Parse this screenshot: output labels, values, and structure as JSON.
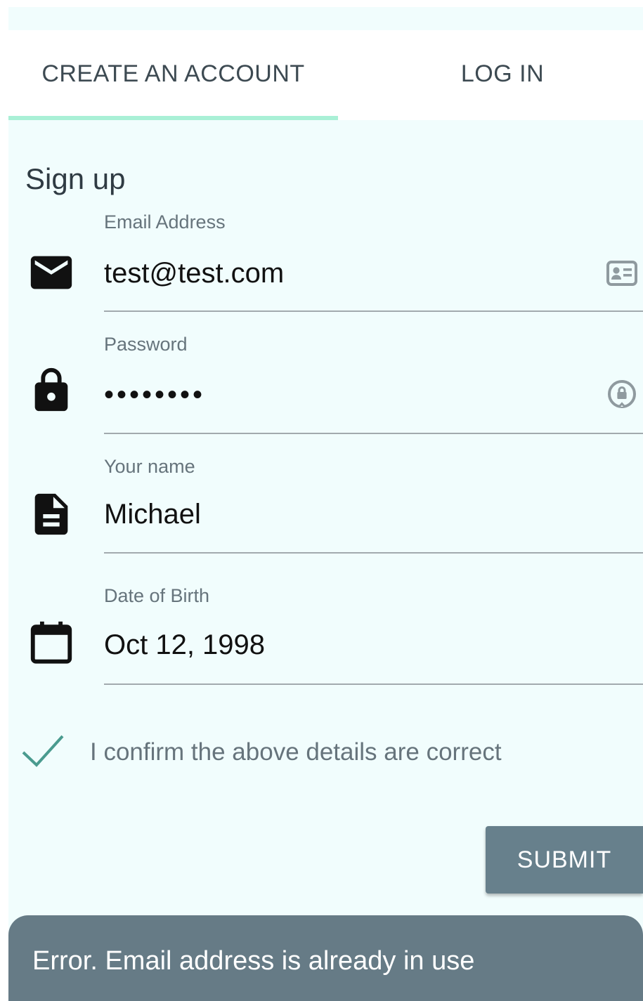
{
  "tabs": {
    "create": "CREATE AN ACCOUNT",
    "login": "LOG IN",
    "accent_color": "#a9f0d6"
  },
  "form": {
    "heading": "Sign up",
    "email": {
      "label": "Email Address",
      "value": "test@test.com",
      "icon": "envelope-icon",
      "trailing_icon": "contact-card-icon"
    },
    "password": {
      "label": "Password",
      "value": "••••••••",
      "icon": "lock-icon",
      "trailing_icon": "password-manager-icon"
    },
    "name": {
      "label": "Your name",
      "value": "Michael",
      "icon": "document-icon"
    },
    "dob": {
      "label": "Date of Birth",
      "value": "Oct 12, 1998",
      "icon": "calendar-icon"
    },
    "confirm": {
      "label": "I confirm the above details are correct",
      "checked": true,
      "icon": "checkmark-icon"
    },
    "submit_label": "SUBMIT"
  },
  "snackbar": {
    "message": "Error. Email address is already in use"
  },
  "colors": {
    "background": "#f1fdfd",
    "button": "#67808c",
    "snackbar": "#667b86",
    "check": "#4a9b8f"
  }
}
